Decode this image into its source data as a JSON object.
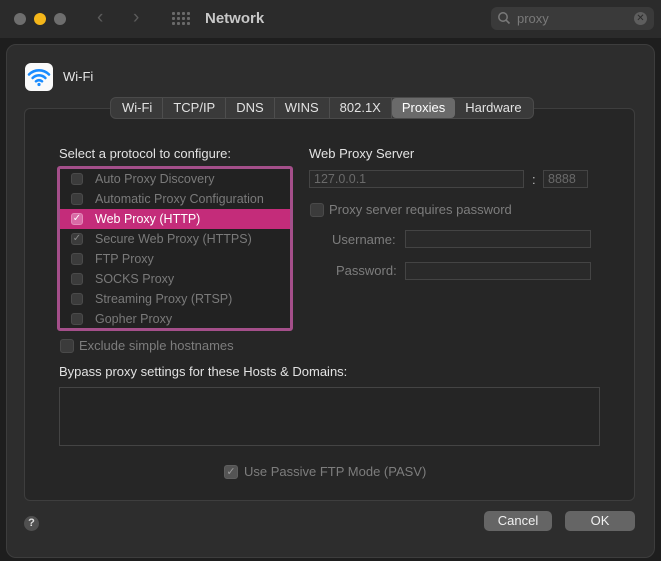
{
  "window": {
    "title": "Network",
    "search": {
      "value": "proxy",
      "placeholder": ""
    }
  },
  "service": {
    "name": "Wi-Fi",
    "icon": "wifi-icon"
  },
  "tabs": [
    {
      "label": "Wi-Fi",
      "active": false
    },
    {
      "label": "TCP/IP",
      "active": false
    },
    {
      "label": "DNS",
      "active": false
    },
    {
      "label": "WINS",
      "active": false
    },
    {
      "label": "802.1X",
      "active": false
    },
    {
      "label": "Proxies",
      "active": true
    },
    {
      "label": "Hardware",
      "active": false
    }
  ],
  "protocols": {
    "heading": "Select a protocol to configure:",
    "items": [
      {
        "label": "Auto Proxy Discovery",
        "checked": false,
        "selected": false
      },
      {
        "label": "Automatic Proxy Configuration",
        "checked": false,
        "selected": false
      },
      {
        "label": "Web Proxy (HTTP)",
        "checked": true,
        "selected": true
      },
      {
        "label": "Secure Web Proxy (HTTPS)",
        "checked": true,
        "selected": false
      },
      {
        "label": "FTP Proxy",
        "checked": false,
        "selected": false
      },
      {
        "label": "SOCKS Proxy",
        "checked": false,
        "selected": false
      },
      {
        "label": "Streaming Proxy (RTSP)",
        "checked": false,
        "selected": false
      },
      {
        "label": "Gopher Proxy",
        "checked": false,
        "selected": false
      }
    ]
  },
  "server": {
    "heading": "Web Proxy Server",
    "host": "127.0.0.1",
    "separator": ":",
    "port": "8888",
    "password_label": "Proxy server requires password",
    "password_required": false,
    "username_label": "Username:",
    "username_value": "",
    "password_field_label": "Password:",
    "password_value": ""
  },
  "exclude_simple_hostnames": {
    "label": "Exclude simple hostnames",
    "checked": false
  },
  "bypass": {
    "label": "Bypass proxy settings for these Hosts & Domains:",
    "value": ""
  },
  "passive_ftp": {
    "label": "Use Passive FTP Mode (PASV)",
    "checked": true
  },
  "buttons": {
    "cancel": "Cancel",
    "ok": "OK",
    "help": "?"
  },
  "colors": {
    "accent": "#c42c7a",
    "highlight_border": "#a44f8a",
    "min_button": "#f4b61a"
  }
}
